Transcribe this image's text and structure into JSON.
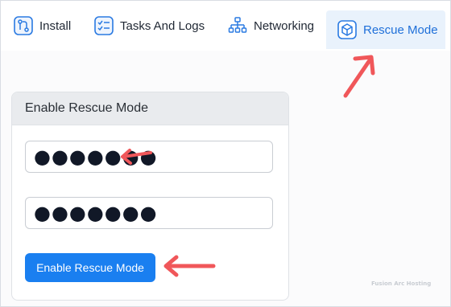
{
  "tabs": [
    {
      "label": "Install",
      "icon": "git-branch-icon"
    },
    {
      "label": "Tasks And Logs",
      "icon": "checklist-icon"
    },
    {
      "label": "Networking",
      "icon": "network-tree-icon"
    },
    {
      "label": "Rescue Mode",
      "icon": "cube-box-icon",
      "active": true
    }
  ],
  "card": {
    "title": "Enable Rescue Mode",
    "password_value": "●●●●●●●",
    "confirm_value": "●●●●●●●",
    "button_label": "Enable Rescue Mode"
  },
  "watermark": "Fusion Arc Hosting",
  "colors": {
    "accent": "#1a7ff0",
    "active_tab_bg": "#e9f2fc",
    "annotation_arrow": "#f0575a"
  }
}
